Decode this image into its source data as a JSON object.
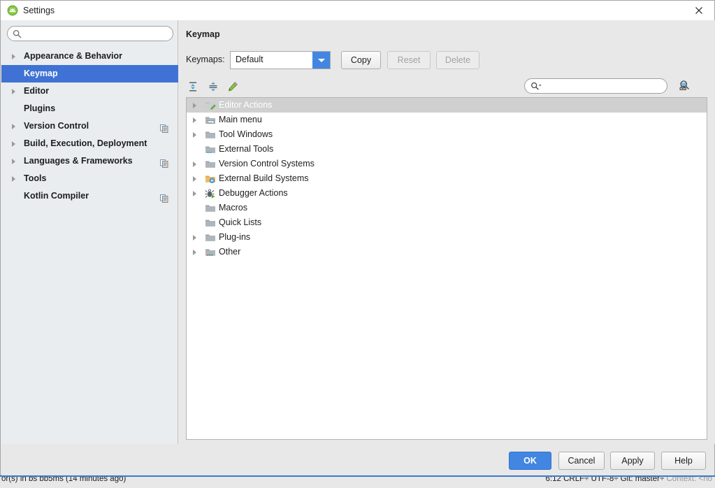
{
  "window": {
    "title": "Settings",
    "app_icon": "android-studio-icon",
    "close_icon": "close-icon"
  },
  "sidebar": {
    "search": {
      "value": "",
      "placeholder": "",
      "icon": "search-icon"
    },
    "items": [
      {
        "label": "Appearance & Behavior",
        "expandable": true,
        "selected": false,
        "project_icon": false
      },
      {
        "label": "Keymap",
        "expandable": false,
        "selected": true,
        "project_icon": false
      },
      {
        "label": "Editor",
        "expandable": true,
        "selected": false,
        "project_icon": false
      },
      {
        "label": "Plugins",
        "expandable": false,
        "selected": false,
        "project_icon": false
      },
      {
        "label": "Version Control",
        "expandable": true,
        "selected": false,
        "project_icon": true
      },
      {
        "label": "Build, Execution, Deployment",
        "expandable": true,
        "selected": false,
        "project_icon": false
      },
      {
        "label": "Languages & Frameworks",
        "expandable": true,
        "selected": false,
        "project_icon": true
      },
      {
        "label": "Tools",
        "expandable": true,
        "selected": false,
        "project_icon": false
      },
      {
        "label": "Kotlin Compiler",
        "expandable": false,
        "selected": false,
        "project_icon": true
      }
    ]
  },
  "content": {
    "page_title": "Keymap",
    "keymaps_label": "Keymaps:",
    "keymap_selected": "Default",
    "keymap_options": [
      "Default"
    ],
    "buttons": [
      {
        "id": "copy",
        "label": "Copy",
        "enabled": true
      },
      {
        "id": "reset",
        "label": "Reset",
        "enabled": false
      },
      {
        "id": "delete",
        "label": "Delete",
        "enabled": false
      }
    ],
    "toolbar": {
      "expand_all_icon": "expand-all-icon",
      "collapse_all_icon": "collapse-all-icon",
      "edit_shortcut_icon": "edit-pencil-icon",
      "find_by_shortcut_icon": "find-by-shortcut-icon",
      "search": {
        "value": "",
        "placeholder": "",
        "icon": "search-dropdown-icon"
      }
    },
    "tree": [
      {
        "label": "Editor Actions",
        "expandable": true,
        "selected": true,
        "icon": "folder-editor-icon"
      },
      {
        "label": "Main menu",
        "expandable": true,
        "selected": false,
        "icon": "folder-menu-icon"
      },
      {
        "label": "Tool Windows",
        "expandable": true,
        "selected": false,
        "icon": "folder-icon"
      },
      {
        "label": "External Tools",
        "expandable": false,
        "selected": false,
        "icon": "folder-tools-icon"
      },
      {
        "label": "Version Control Systems",
        "expandable": true,
        "selected": false,
        "icon": "folder-icon"
      },
      {
        "label": "External Build Systems",
        "expandable": true,
        "selected": false,
        "icon": "folder-build-icon"
      },
      {
        "label": "Debugger Actions",
        "expandable": true,
        "selected": false,
        "icon": "debugger-bug-icon"
      },
      {
        "label": "Macros",
        "expandable": false,
        "selected": false,
        "icon": "folder-icon"
      },
      {
        "label": "Quick Lists",
        "expandable": false,
        "selected": false,
        "icon": "folder-icon"
      },
      {
        "label": "Plug-ins",
        "expandable": true,
        "selected": false,
        "icon": "folder-icon"
      },
      {
        "label": "Other",
        "expandable": true,
        "selected": false,
        "icon": "folder-other-icon"
      }
    ]
  },
  "footer": {
    "ok": "OK",
    "cancel": "Cancel",
    "apply": "Apply",
    "help": "Help"
  },
  "statusbar": {
    "left": "or(s) in bs bb5ms (14 minutes ago)",
    "right": "6:12   CRLF÷   UTF-8÷   Git: master÷",
    "right_dim": "Context: <no"
  },
  "colors": {
    "accent_blue": "#3f72d4",
    "button_blue": "#4286e2",
    "sidebar_bg": "#e9edf0",
    "dialog_bg": "#e8e8e8",
    "tree_selection": "#d0d0d0",
    "statusbar_border": "#3a7bd0"
  }
}
